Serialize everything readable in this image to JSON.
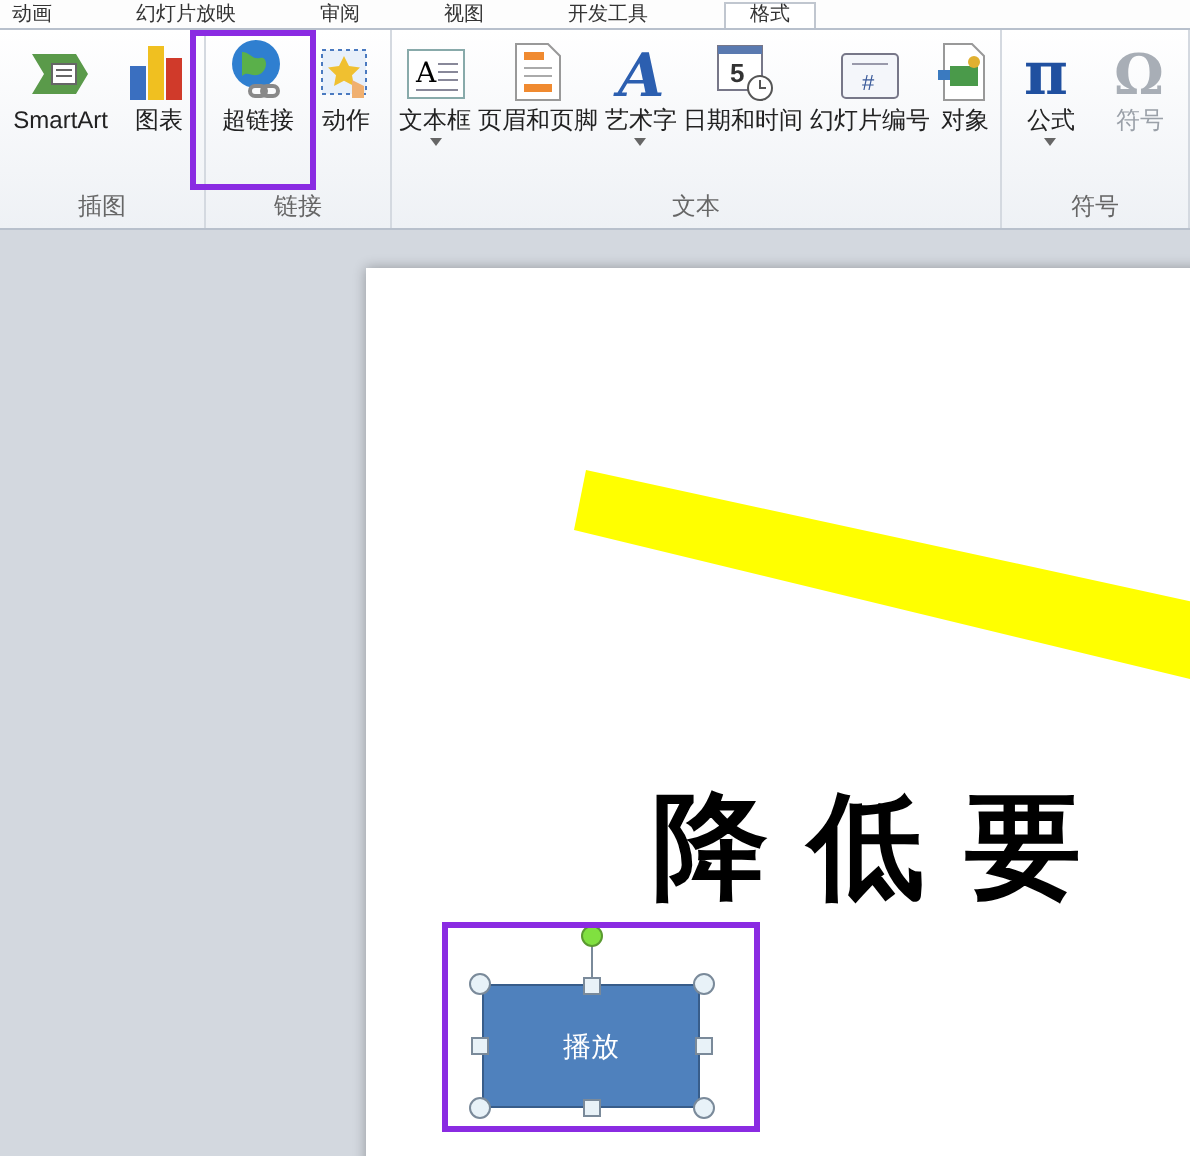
{
  "ribbon_tabs": [
    {
      "label": "动画",
      "selected": false
    },
    {
      "label": "幻灯片放映",
      "selected": false
    },
    {
      "label": "审阅",
      "selected": false
    },
    {
      "label": "视图",
      "selected": false
    },
    {
      "label": "开发工具",
      "selected": false
    },
    {
      "label": "格式",
      "selected": true
    }
  ],
  "ribbon_groups": [
    {
      "label": "插图",
      "items": [
        {
          "label": "SmartArt",
          "dropdown": false,
          "disabled": false
        },
        {
          "label": "图表",
          "dropdown": false,
          "disabled": false
        }
      ]
    },
    {
      "label": "链接",
      "items": [
        {
          "label": "超链接",
          "dropdown": false,
          "disabled": false
        },
        {
          "label": "动作",
          "dropdown": false,
          "disabled": false
        }
      ]
    },
    {
      "label": "文本",
      "items": [
        {
          "label": "文本框",
          "icon_text": "A",
          "dropdown": true,
          "disabled": false
        },
        {
          "label": "页眉和页脚",
          "dropdown": false,
          "disabled": false
        },
        {
          "label": "艺术字",
          "icon_text": "A",
          "dropdown": true,
          "disabled": false
        },
        {
          "label": "日期和时间",
          "icon_text": "5",
          "dropdown": false,
          "disabled": false
        },
        {
          "label": "幻灯片编号",
          "icon_text": "#",
          "dropdown": false,
          "disabled": false
        },
        {
          "label": "对象",
          "dropdown": false,
          "disabled": false
        }
      ]
    },
    {
      "label": "符号",
      "items": [
        {
          "label": "公式",
          "icon_text": "π",
          "dropdown": true,
          "disabled": false
        },
        {
          "label": "符号",
          "icon_text": "Ω",
          "dropdown": false,
          "disabled": true
        }
      ]
    }
  ],
  "slide": {
    "title": "降 低 要",
    "shape": {
      "label": "播放",
      "selected": true
    }
  }
}
